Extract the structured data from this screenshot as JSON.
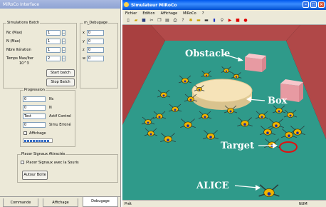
{
  "left_window": {
    "title": "MiRoCo Interface",
    "batch": {
      "legend": "Simulations Batch",
      "nc_label": "Nc (Max)",
      "nc_value": "1",
      "n_label": "N (Max)",
      "n_value": "1",
      "iter_label": "Nbre Itération",
      "iter_value": "1",
      "time_label": "Temps Max/Iter",
      "time_unit": "10^3",
      "time_value": "2",
      "start_button": "Start batch",
      "stop_button": "Stop Batch"
    },
    "debug": {
      "legend": "m_Debugage",
      "x_label": "x",
      "x_value": "0",
      "y_label": "y",
      "y_value": "0",
      "z_label": "z",
      "z_value": "0",
      "w_label": "w",
      "w_value": "0"
    },
    "progression": {
      "legend": "Progression",
      "nc_value": "0",
      "nc_label": "Nc",
      "n_value": "0",
      "n_label": "N",
      "test_value": "Test",
      "test_label": "Actif Control",
      "simu_value": "0",
      "simu_label": "Simu Erroné",
      "affichage_label": "Affichage",
      "progress_blocks": 9
    },
    "signals": {
      "legend": "Placer Signaux Attractés",
      "checkbox_label": "Placer Signaux avec la Souris",
      "button": "Autour Boite"
    },
    "tabs": [
      "Commande",
      "Affichage",
      "Debugage"
    ]
  },
  "sim_window": {
    "title": "Simulateur MiRoCo",
    "menu": [
      "Fichier",
      "Edition",
      "Affichage",
      "MiRoCo",
      "?"
    ],
    "labels": {
      "obstacle": "Obstacle",
      "box": "Box",
      "target": "Target",
      "alice": "ALICE"
    },
    "status_left": "Prêt",
    "status_right": "NUM",
    "colors": {
      "floor": "#2f9a8a",
      "wall": "#b24a4a",
      "obstacle": "#f2b7bc",
      "box": "#f6e3b8",
      "target": "#e01010",
      "robot": "#f0b400"
    }
  }
}
